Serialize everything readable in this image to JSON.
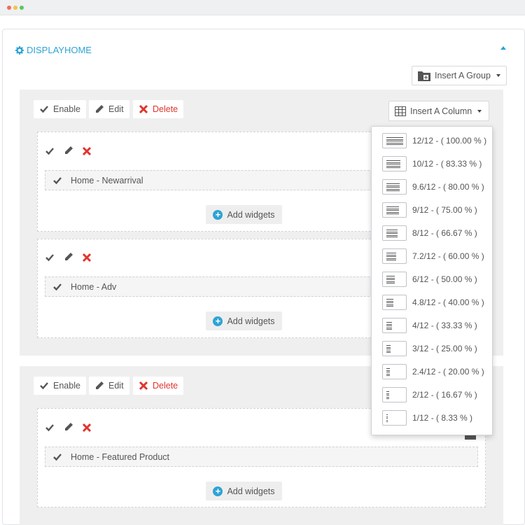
{
  "hook": {
    "title": "DISPLAYHOME",
    "title_icon": "gear-icon"
  },
  "toolbar": {
    "insert_group_label": "Insert A Group",
    "insert_column_label": "Insert A Column"
  },
  "group_actions": {
    "enable": "Enable",
    "edit": "Edit",
    "delete": "Delete"
  },
  "widgets": {
    "w1": "Home - Newarrival",
    "w2": "Home - Adv",
    "w3": "Home - Featured Product"
  },
  "add_widgets_label": "Add widgets",
  "column_widths": [
    "12/12 - ( 100.00 % )",
    "10/12 - ( 83.33 % )",
    "9.6/12 - ( 80.00 % )",
    "9/12 - ( 75.00 % )",
    "8/12 - ( 66.67 % )",
    "7.2/12 - ( 60.00 % )",
    "6/12 - ( 50.00 % )",
    "4.8/12 - ( 40.00 % )",
    "4/12 - ( 33.33 % )",
    "3/12 - ( 25.00 % )",
    "2.4/12 - ( 20.00 % )",
    "2/12 - ( 16.67 % )",
    "1/12 - ( 8.33 % )"
  ],
  "colors": {
    "accent": "#2ea3d5",
    "danger": "#e0342e",
    "group_bg": "#efefef"
  }
}
